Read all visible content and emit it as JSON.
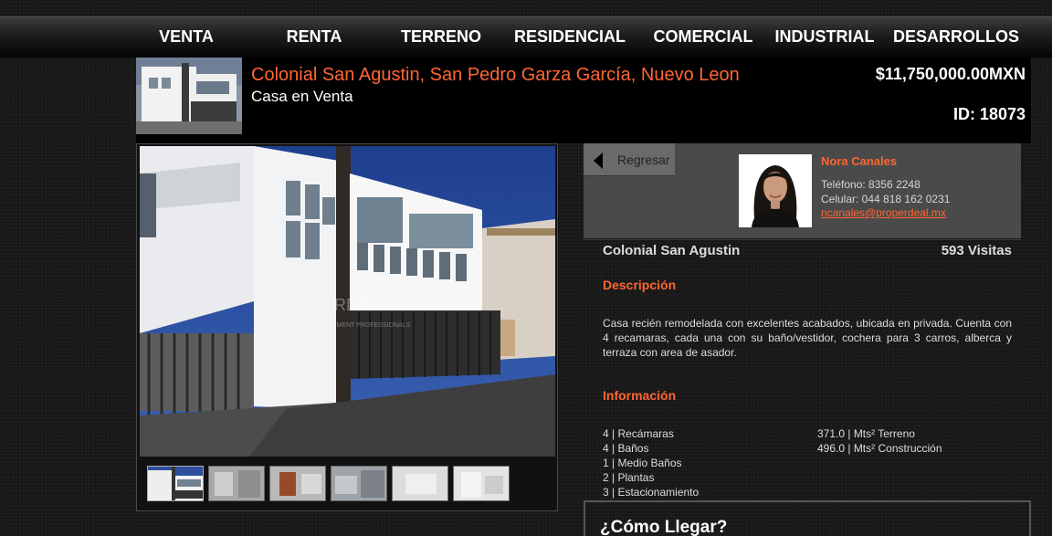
{
  "nav": {
    "items": [
      "VENTA",
      "RENTA",
      "TERRENO",
      "RESIDENCIAL",
      "COMERCIAL",
      "INDUSTRIAL",
      "DESARROLLOS"
    ]
  },
  "listing": {
    "title": "Colonial San Agustin, San Pedro Garza García, Nuevo Leon",
    "subtitle": "Casa en Venta",
    "price": "$11,750,000.00MXN",
    "id_text": "ID: 18073"
  },
  "agent": {
    "back_label": "Regresar",
    "name": "Nora Canales",
    "phone": "Teléfono: 8356 2248",
    "cell": "Celular: 044 818 162 0231",
    "email": "ncanales@properdeal.mx"
  },
  "details": {
    "location": "Colonial San Agustin",
    "visits": "593 Visitas",
    "desc_heading": "Descripción",
    "description": "Casa recién remodelada con excelentes acabados, ubicada en privada. Cuenta con 4 recamaras, cada una con su baño/vestidor, cochera para 3 carros, alberca y terraza con area de asador.",
    "info_heading": "Información",
    "specs_left": [
      "4 | Recámaras",
      "4 | Baños",
      "1 | Medio Baños",
      "2 | Plantas",
      "3 | Estacionamiento"
    ],
    "specs_right": [
      "371.0 | Mts² Terreno",
      "496.0 | Mts² Construcción"
    ]
  },
  "watermark": {
    "brand": "PROPERDEAL",
    "tagline": "PROPERTY INVESTMENT PROFESSIONALS"
  },
  "directions": {
    "title": "¿Cómo Llegar?"
  },
  "colors": {
    "accent": "#ff6633",
    "background": "#1b1b1b",
    "header_band": "#000000",
    "agent_panel": "#4a4a4a"
  }
}
